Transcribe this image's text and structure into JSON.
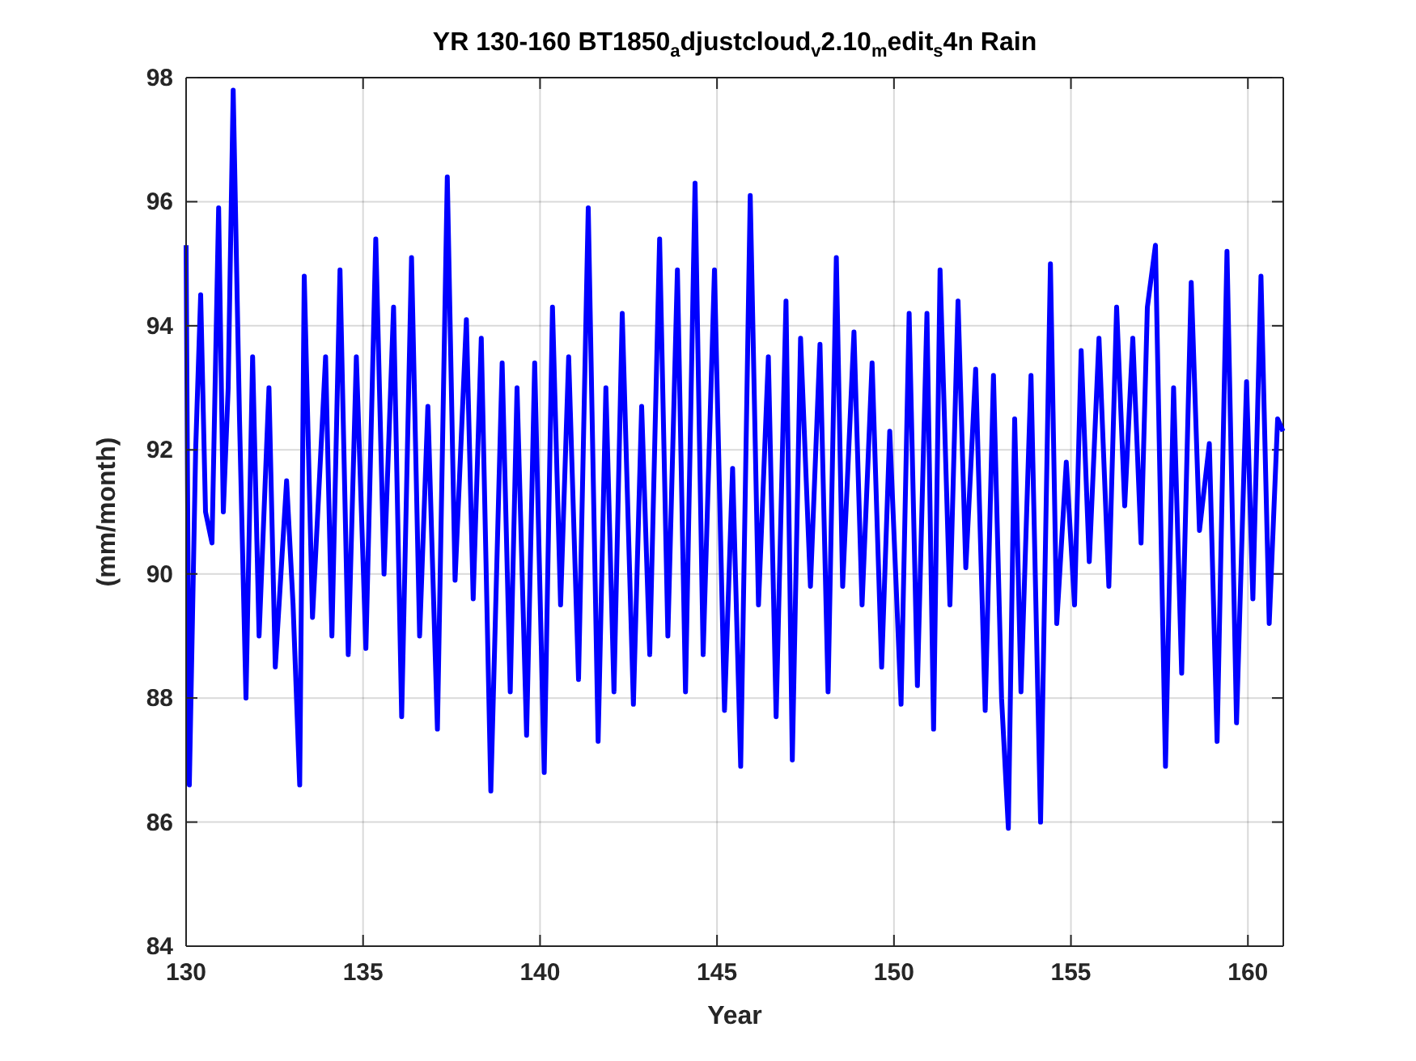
{
  "figure": {
    "chart_data": {
      "type": "line",
      "title": "YR 130-160 BT1850$_{a}$djustcloud$_{v}$2.10$_{m}$edit$_{s}$4n Rain",
      "xlabel": "Year",
      "ylabel": "(mm/month)",
      "x": [
        130.0,
        130.09,
        130.27,
        130.41,
        130.55,
        130.73,
        130.92,
        131.05,
        131.19,
        131.33,
        131.51,
        131.69,
        131.88,
        132.06,
        132.34,
        132.52,
        132.84,
        133.02,
        133.21,
        133.34,
        133.57,
        133.94,
        134.12,
        134.35,
        134.58,
        134.81,
        135.08,
        135.36,
        135.59,
        135.86,
        136.09,
        136.37,
        136.6,
        136.83,
        137.1,
        137.38,
        137.6,
        137.92,
        138.11,
        138.34,
        138.61,
        138.93,
        139.16,
        139.35,
        139.62,
        139.85,
        140.12,
        140.35,
        140.58,
        140.81,
        141.09,
        141.36,
        141.64,
        141.86,
        142.09,
        142.32,
        142.64,
        142.87,
        143.1,
        143.38,
        143.61,
        143.88,
        144.11,
        144.38,
        144.61,
        144.93,
        145.21,
        145.44,
        145.67,
        145.94,
        146.17,
        146.45,
        146.67,
        146.95,
        147.13,
        147.36,
        147.64,
        147.91,
        148.14,
        148.37,
        148.55,
        148.87,
        149.1,
        149.38,
        149.65,
        149.88,
        150.2,
        150.43,
        150.66,
        150.93,
        151.12,
        151.3,
        151.58,
        151.81,
        152.03,
        152.31,
        152.58,
        152.81,
        153.04,
        153.23,
        153.41,
        153.59,
        153.87,
        154.14,
        154.42,
        154.6,
        154.87,
        155.1,
        155.29,
        155.52,
        155.79,
        156.07,
        156.29,
        156.52,
        156.75,
        156.98,
        157.16,
        157.39,
        157.67,
        157.9,
        158.13,
        158.4,
        158.63,
        158.91,
        159.13,
        159.41,
        159.68,
        159.96,
        160.14,
        160.37,
        160.6,
        160.84,
        160.99
      ],
      "series": [
        {
          "color": "#0000ff",
          "values": [
            95.3,
            86.6,
            92,
            94.5,
            91,
            90.5,
            95.9,
            91,
            93,
            97.8,
            92.5,
            88,
            93.5,
            89,
            93,
            88.5,
            91.5,
            89.5,
            86.6,
            94.8,
            89.3,
            93.5,
            89,
            94.9,
            88.7,
            93.5,
            88.8,
            95.4,
            90,
            94.3,
            87.7,
            95.1,
            89,
            92.7,
            87.5,
            96.4,
            89.9,
            94.1,
            89.6,
            93.8,
            86.5,
            93.4,
            88.1,
            93,
            87.4,
            93.4,
            86.8,
            94.3,
            89.5,
            93.5,
            88.3,
            95.9,
            87.3,
            93,
            88.1,
            94.2,
            87.9,
            92.7,
            88.7,
            95.4,
            89,
            94.9,
            88.1,
            96.3,
            88.7,
            94.9,
            87.8,
            91.7,
            86.9,
            96.1,
            89.5,
            93.5,
            87.7,
            94.4,
            87,
            93.8,
            89.8,
            93.7,
            88.1,
            95.1,
            89.8,
            93.9,
            89.5,
            93.4,
            88.5,
            92.3,
            87.9,
            94.2,
            88.2,
            94.2,
            87.5,
            94.9,
            89.5,
            94.4,
            90.1,
            93.3,
            87.8,
            93.2,
            88,
            85.9,
            92.5,
            88.1,
            93.2,
            86,
            95,
            89.2,
            91.8,
            89.5,
            93.6,
            90.2,
            93.8,
            89.8,
            94.3,
            91.1,
            93.8,
            90.5,
            94.3,
            95.3,
            86.9,
            93,
            88.4,
            94.7,
            90.7,
            92.1,
            87.3,
            95.2,
            87.6,
            93.1,
            89.6,
            94.8,
            89.2,
            92.5,
            92.3
          ]
        }
      ],
      "grid": true,
      "xlim": [
        130,
        161
      ],
      "ylim": [
        84,
        98
      ],
      "xticks": [
        130,
        135,
        140,
        145,
        150,
        155,
        160
      ],
      "yticks": [
        84,
        86,
        88,
        90,
        92,
        94,
        96,
        98
      ]
    }
  }
}
